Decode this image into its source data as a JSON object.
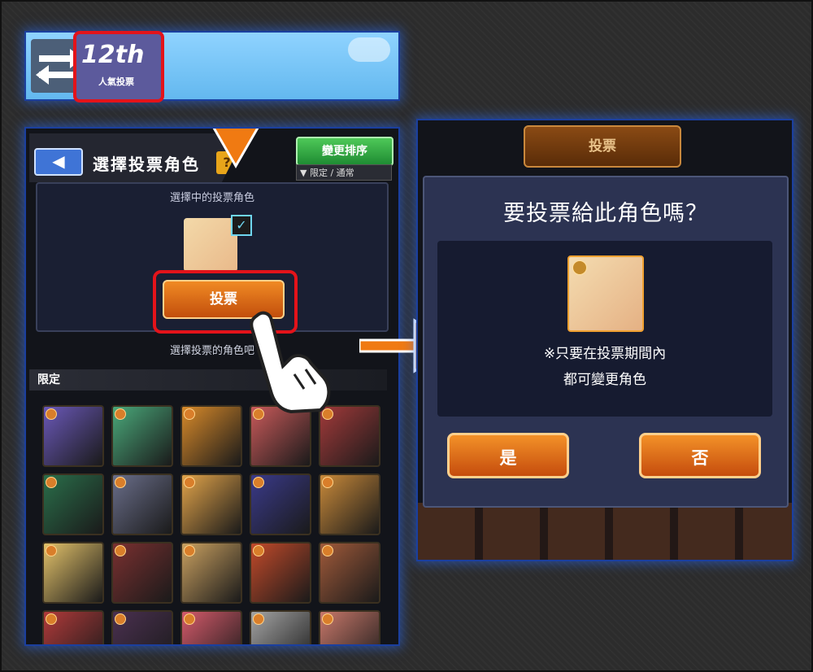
{
  "banner": {
    "swap_icon": "swap-arrows-icon",
    "event_number": "12th",
    "event_label": "人氣投票"
  },
  "left_panel": {
    "back_icon": "back-arrow-icon",
    "title": "選擇投票角色",
    "help_label": "?",
    "sort_button": "變更排序",
    "filter_label": "限定 / 通常",
    "selected_label": "選擇中的投票角色",
    "vote_button": "投票",
    "hint_text": "選擇投票的角色吧",
    "section_label": "限定",
    "grid_colors": [
      [
        "#6a58b8",
        "#4aa87a",
        "#d88a2a",
        "#c95a5a",
        "#a23a3a"
      ],
      [
        "#2a6e4a",
        "#6a6e8a",
        "#e2a44a",
        "#3a3a8a",
        "#c98a3a"
      ],
      [
        "#e3c26a",
        "#7a3030",
        "#c9a060",
        "#c24a2a",
        "#a05a3a"
      ],
      [
        "#b03a3a",
        "#4a3050",
        "#d45a6a",
        "#a4a4a4",
        "#c8786a"
      ]
    ]
  },
  "right_panel": {
    "header": "投票",
    "dialog_title": "要投票給此角色嗎？",
    "note_line1": "※只要在投票期間內",
    "note_line2": "都可變更角色",
    "yes_button": "是",
    "no_button": "否"
  }
}
